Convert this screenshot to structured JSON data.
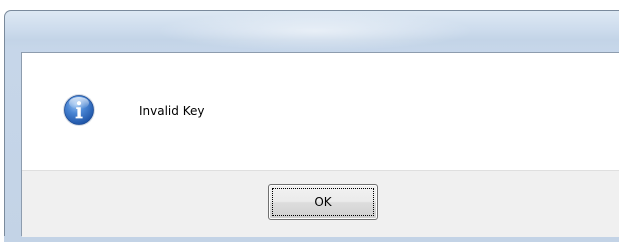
{
  "dialog": {
    "icon": "information-icon",
    "message": "Invalid Key",
    "ok_label": "OK"
  },
  "colors": {
    "title_bar": "#c3d4e7",
    "frame": "#c3d3e6",
    "content_background": "#ffffff",
    "footer_background": "#f0f0f0",
    "icon_blue": "#2f6fc4"
  }
}
